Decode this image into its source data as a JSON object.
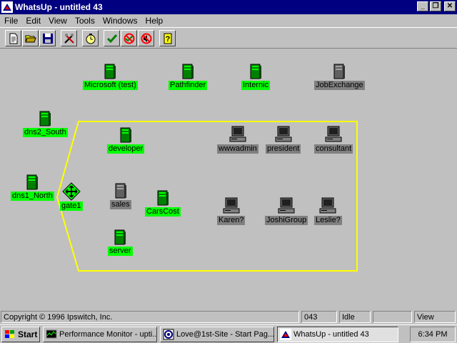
{
  "window": {
    "title": "WhatsUp - untitled 43",
    "controls": {
      "minimize": "_",
      "restore": "❐",
      "close": "✕"
    }
  },
  "menu": [
    "File",
    "Edit",
    "View",
    "Tools",
    "Windows",
    "Help"
  ],
  "toolbar": {
    "buttons": [
      "new-icon",
      "open-icon",
      "save-icon",
      "tools-icon",
      "timer-icon",
      "check-icon",
      "stop-poll-icon",
      "no-sound-icon",
      "help-icon"
    ]
  },
  "map": {
    "nodes": [
      {
        "label": "Microsoft (test)",
        "status": "up",
        "type": "server"
      },
      {
        "label": "Pathfinder",
        "status": "up",
        "type": "server"
      },
      {
        "label": "Internic",
        "status": "up",
        "type": "server"
      },
      {
        "label": "JobExchange",
        "status": "unknown",
        "type": "server"
      },
      {
        "label": "dns2_South",
        "status": "up",
        "type": "server"
      },
      {
        "label": "developer",
        "status": "up",
        "type": "server"
      },
      {
        "label": "wwwadmin",
        "status": "unknown",
        "type": "workstation"
      },
      {
        "label": "president",
        "status": "unknown",
        "type": "workstation"
      },
      {
        "label": "consultant",
        "status": "unknown",
        "type": "workstation"
      },
      {
        "label": "dns1_North",
        "status": "up",
        "type": "server"
      },
      {
        "label": "gate1",
        "status": "up",
        "type": "router"
      },
      {
        "label": "sales",
        "status": "unknown",
        "type": "server"
      },
      {
        "label": "CarsCost",
        "status": "up",
        "type": "server"
      },
      {
        "label": "Karen?",
        "status": "unknown",
        "type": "workstation"
      },
      {
        "label": "JoshiGroup",
        "status": "unknown",
        "type": "workstation"
      },
      {
        "label": "Leslie?",
        "status": "unknown",
        "type": "workstation"
      },
      {
        "label": "server",
        "status": "up",
        "type": "server"
      }
    ],
    "colors": {
      "up": "#00ff00",
      "unknown": "#808080",
      "network_outline": "#ffff00",
      "background": "#c0c0c0"
    }
  },
  "statusbar": {
    "copyright": "Copyright © 1996 Ipswitch, Inc.",
    "count": "043",
    "state": "Idle",
    "blank": "",
    "mode": "View"
  },
  "taskbar": {
    "start_label": "Start",
    "tasks": [
      {
        "label": "Performance Monitor - upti...",
        "icon": "perfmon-icon",
        "active": false
      },
      {
        "label": "Love@1st-Site - Start Pag...",
        "icon": "browser-icon",
        "active": false
      },
      {
        "label": "WhatsUp - untitled 43",
        "icon": "whatsup-icon",
        "active": true
      }
    ],
    "clock": "6:34 PM"
  }
}
